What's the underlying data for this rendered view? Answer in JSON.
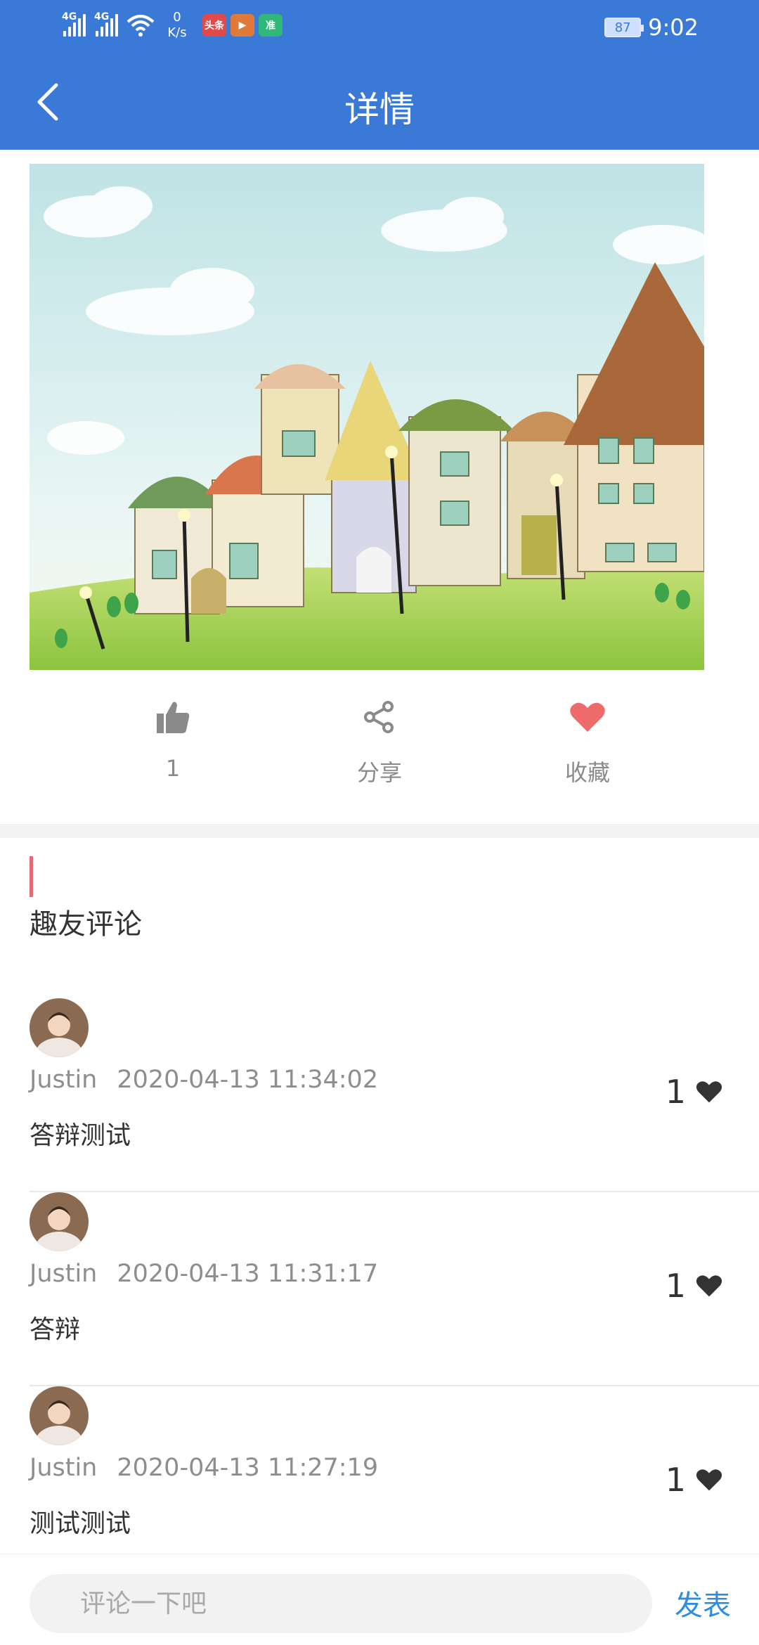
{
  "status_bar": {
    "signal1_label": "4G",
    "signal2_label": "4G",
    "net_speed_value": "0",
    "net_speed_unit": "K/s",
    "app_badges": [
      "头条",
      "▶",
      "准"
    ],
    "battery": "87",
    "time": "9:02"
  },
  "navbar": {
    "title": "详情",
    "back_icon": "chevron-left-icon"
  },
  "actions": {
    "like_count": "1",
    "share_label": "分享",
    "favorite_label": "收藏",
    "colors": {
      "icon_gray": "#8a8a8a",
      "favorite_red": "#ee6b6b"
    }
  },
  "comments": {
    "section_title": "趣友评论",
    "items": [
      {
        "user": "Justin",
        "time": "2020-04-13 11:34:02",
        "text": "答辩测试",
        "likes": "1"
      },
      {
        "user": "Justin",
        "time": "2020-04-13 11:31:17",
        "text": "答辩",
        "likes": "1"
      },
      {
        "user": "Justin",
        "time": "2020-04-13 11:27:19",
        "text": "测试测试",
        "likes": "1"
      }
    ]
  },
  "bottom_bar": {
    "input_placeholder": "评论一下吧",
    "publish_label": "发表"
  },
  "colors": {
    "header_blue": "#3a7ad6",
    "accent_red": "#e06c75",
    "publish_blue": "#2f8de0"
  }
}
